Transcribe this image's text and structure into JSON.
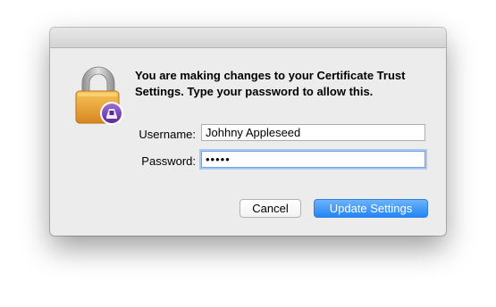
{
  "dialog": {
    "message": "You are making changes to your Certificate Trust Settings. Type your password to allow this.",
    "username_label": "Username:",
    "username_value": "Johhny Appleseed",
    "password_label": "Password:",
    "password_value": "•••••",
    "cancel_label": "Cancel",
    "update_label": "Update Settings"
  },
  "icons": {
    "lock": "padlock-icon",
    "badge": "certificate-assistant-badge-icon"
  },
  "colors": {
    "accent": "#2385f6",
    "lock_gold": "#f0a43c",
    "badge_purple": "#7a46b8"
  }
}
